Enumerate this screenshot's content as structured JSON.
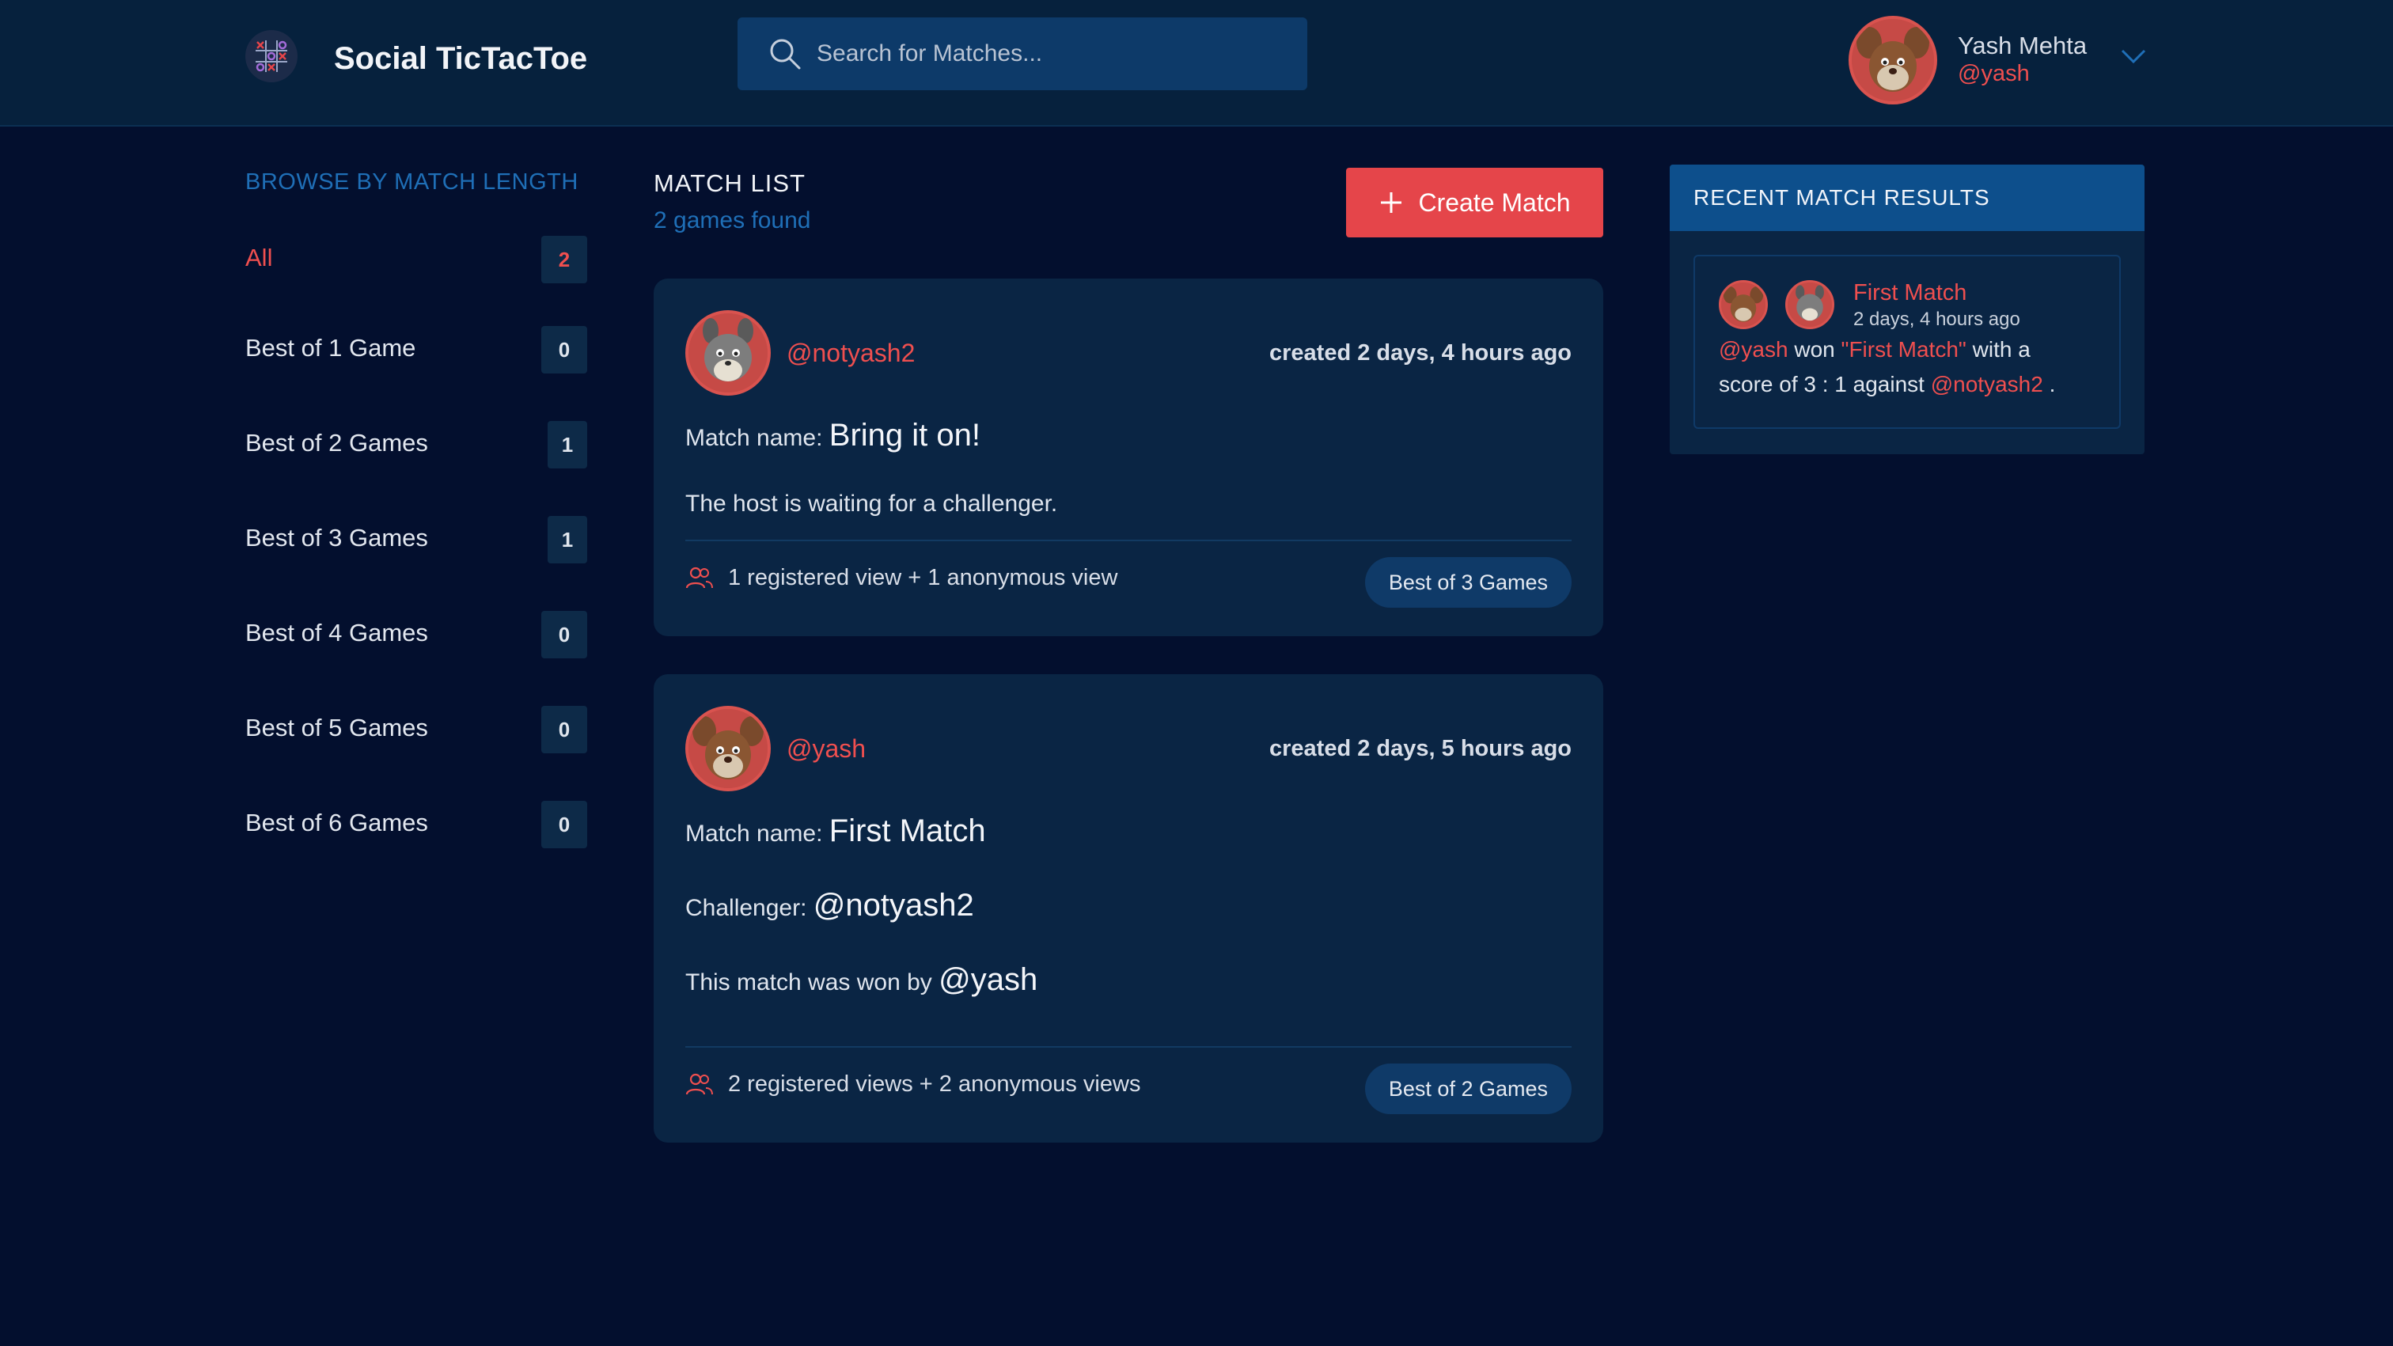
{
  "header": {
    "app_title": "Social TicTacToe",
    "search_placeholder": "Search for Matches...",
    "user": {
      "name": "Yash Mehta",
      "handle": "@yash"
    }
  },
  "sidebar": {
    "title": "BROWSE BY MATCH LENGTH",
    "items": [
      {
        "label": "All",
        "count": "2",
        "active": true
      },
      {
        "label": "Best of 1 Game",
        "count": "0"
      },
      {
        "label": "Best of 2 Games",
        "count": "1"
      },
      {
        "label": "Best of 3 Games",
        "count": "1"
      },
      {
        "label": "Best of 4 Games",
        "count": "0"
      },
      {
        "label": "Best of 5 Games",
        "count": "0"
      },
      {
        "label": "Best of 6 Games",
        "count": "0"
      }
    ]
  },
  "match_list": {
    "title": "MATCH LIST",
    "subtitle": "2 games found",
    "create_label": "Create Match",
    "matches": [
      {
        "host": "@notyash2",
        "created": "created 2 days, 4 hours ago",
        "name_label": "Match name:",
        "name": "Bring it on!",
        "status": "The host is waiting for a challenger.",
        "views": "1 registered view + 1 anonymous view",
        "length": "Best of 3 Games"
      },
      {
        "host": "@yash",
        "created": "created 2 days, 5 hours ago",
        "name_label": "Match name:",
        "name": "First Match",
        "challenger_label": "Challenger:",
        "challenger": "@notyash2",
        "winner_label": "This match was won by",
        "winner": "@yash",
        "views": "2 registered views + 2 anonymous views",
        "length": "Best of 2 Games"
      }
    ]
  },
  "recent_results": {
    "title": "RECENT MATCH RESULTS",
    "items": [
      {
        "match": "First Match",
        "time": "2 days, 4 hours ago",
        "winner": "@yash",
        "won_text": "won",
        "match_quoted": "\"First Match\"",
        "with_text": "with a",
        "score_text": "score of 3 : 1 against",
        "loser": "@notyash2",
        "end": "."
      }
    ]
  },
  "colors": {
    "background": "#030f2e",
    "header": "#06213d",
    "card": "#0a2544",
    "accent_red": "#e5454a",
    "accent_blue": "#1f6fb7"
  }
}
